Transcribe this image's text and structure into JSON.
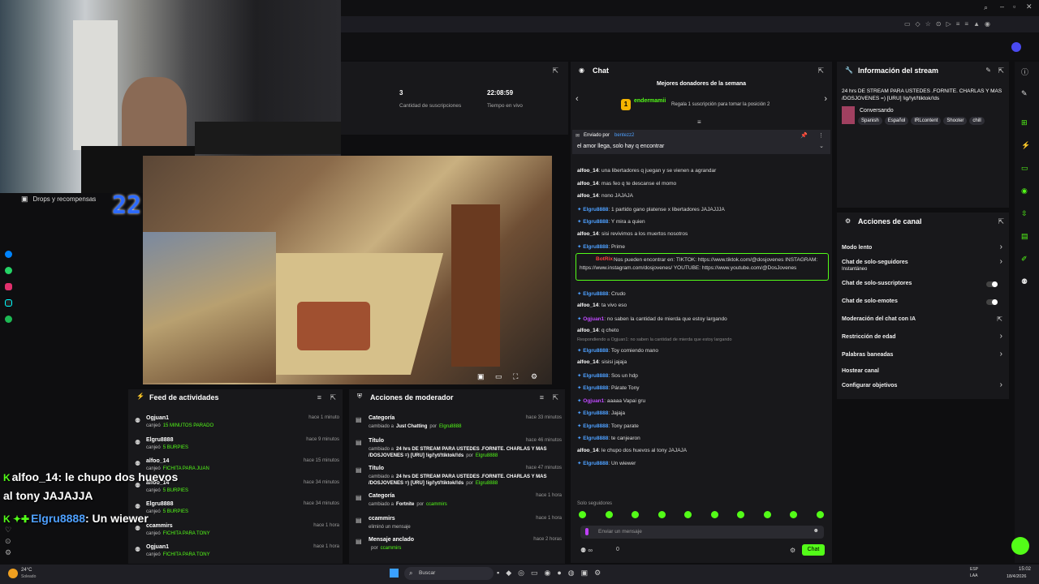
{
  "drops": {
    "label": "Drops y recompensas",
    "timer": "22:2:48"
  },
  "stats": [
    {
      "value": "3",
      "label": "Cantidad de suscripciones"
    },
    {
      "value": "22:08:59",
      "label": "Tiempo en vivo"
    }
  ],
  "chat": {
    "title": "Chat",
    "donors_title": "Mejores donadores de la semana",
    "donor_name": "endermamii",
    "donor_rank": "1",
    "donor_msg": "Regala 1 suscripción para tomar la posición 2",
    "pinned_by": "Enviado por",
    "pinned_user": "bentezz2",
    "pinned_text": "el amor llega, solo hay q encontrar",
    "messages": [
      {
        "user": "alfoo_14",
        "text": "una libertadores q juegan y se vienen a agrandar"
      },
      {
        "user": "alfoo_14",
        "text": "mas feo q te descanse el momo"
      },
      {
        "user": "alfoo_14",
        "text": "nono JAJAJA"
      },
      {
        "user": "Elgru8888",
        "text": "1 partido gano platense x libertadores JAJAJJJA"
      },
      {
        "user": "Elgru8888",
        "text": "Y mira a quien"
      },
      {
        "user": "alfoo_14",
        "text": "sisi revivimos a los muertos nosotros"
      },
      {
        "user": "Elgru8888",
        "text": "Prime"
      },
      {
        "user": "BotRix",
        "text": "Nos pueden encontrar en: TIKTOK: https://www.tiktok.com/@dosjovenes INSTAGRAM: https://www.instagram.com/dosjovenes/ YOUTUBE: https://www.youtube.com/@DosJovenes"
      },
      {
        "user": "Elgru8888",
        "text": "Crudo"
      },
      {
        "user": "alfoo_14",
        "text": "ta vivo eso"
      },
      {
        "user": "Ogjuan1",
        "text": "no saben la cantidad de mierda que estoy largando"
      },
      {
        "user": "alfoo_14",
        "text": "q cheto"
      },
      {
        "user": "Elgru8888",
        "text": "Toy comiendo mano",
        "reply": "Respondiendo a Ogjuan1: no saben la cantidad de mierda que estoy largando"
      },
      {
        "user": "alfoo_14",
        "text": "sisisi jajaja"
      },
      {
        "user": "Elgru8888",
        "text": "Sos un hdp"
      },
      {
        "user": "Elgru8888",
        "text": "Párate Tony"
      },
      {
        "user": "Ogjuan1",
        "text": "aaaaa Vapai gru"
      },
      {
        "user": "Elgru8888",
        "text": "Jajaja"
      },
      {
        "user": "Elgru8888",
        "text": "Tony parate"
      },
      {
        "user": "Elgru8888",
        "text": "te canjearon"
      },
      {
        "user": "alfoo_14",
        "text": "le chupo dos huevos al tony JAJAJA"
      },
      {
        "user": "Elgru8888",
        "text": "Un wiewer"
      }
    ],
    "followers_only": "Solo seguidores",
    "input_placeholder": "Enviar un mensaje",
    "send_label": "Chat",
    "count": "0"
  },
  "info": {
    "title": "Información del stream",
    "stream_title": "24 hrs DE STREAM PARA USTEDES .FORNITE. CHARLAS Y MAS /DOSJOVENES =) [URU] !ig/!yt/!tiktok/!ds",
    "category": "Conversando",
    "tags": [
      "Spanish",
      "Español",
      "IRLcontent",
      "Shooter",
      "chill"
    ]
  },
  "actions": {
    "title": "Acciones de canal",
    "items": [
      {
        "label": "Modo lento",
        "type": "chevron"
      },
      {
        "label": "Chat de solo-seguidores",
        "sub": "Instantáneo",
        "type": "chevron"
      },
      {
        "label": "Chat de solo-suscriptores",
        "type": "toggle"
      },
      {
        "label": "Chat de solo-emotes",
        "type": "toggle"
      },
      {
        "label": "Moderación del chat con IA",
        "type": "external"
      },
      {
        "label": "Restricción de edad",
        "type": "chevron"
      },
      {
        "label": "Palabras baneadas",
        "type": "chevron"
      },
      {
        "label": "Hostear canal",
        "type": "none"
      },
      {
        "label": "Configurar objetivos",
        "type": "chevron"
      }
    ]
  },
  "feed": {
    "title": "Feed de actividades",
    "items": [
      {
        "name": "Ogjuan1",
        "action": "canjeó",
        "reward": "15 MINUTOS PARADO",
        "time": "hace 1 minuto"
      },
      {
        "name": "Elgru8888",
        "action": "canjeó",
        "reward": "5 BURPIES",
        "time": "hace 9 minutos"
      },
      {
        "name": "alfoo_14",
        "action": "canjeó",
        "reward": "FICHITA PARA JUAN",
        "time": "hace 15 minutos"
      },
      {
        "name": "alfoo_14",
        "action": "canjeó",
        "reward": "5 BURPIES",
        "time": "hace 34 minutos"
      },
      {
        "name": "Elgru8888",
        "action": "canjeó",
        "reward": "5 BURPIES",
        "time": "hace 34 minutos"
      },
      {
        "name": "ccammirs",
        "action": "canjeó",
        "reward": "FICHITA PARA TONY",
        "time": "hace 1 hora"
      },
      {
        "name": "Ogjuan1",
        "action": "canjeó",
        "reward": "FICHITA PARA TONY",
        "time": "hace 1 hora"
      }
    ]
  },
  "mod": {
    "title": "Acciones de moderador",
    "items": [
      {
        "name": "Categoría",
        "desc": "cambiado a",
        "val": "Just Chatting",
        "by": "por",
        "user": "Elgru8888",
        "time": "hace 33 minutos"
      },
      {
        "name": "Título",
        "desc": "cambiado a",
        "val": "24 hrs DE STREAM PARA USTEDES .FORNITE. CHARLAS Y MAS /DOSJOVENES =) [URU] !ig/!yt/!tiktok/!ds",
        "by": "por",
        "user": "Elgru8888",
        "time": "hace 46 minutos"
      },
      {
        "name": "Título",
        "desc": "cambiado a",
        "val": "24 hrs DE STREAM PARA USTEDES .FORNITE. CHARLAS Y MAS /DOSJOVENES =) [URU] !ig/!yt/!tiktok/!ds",
        "by": "por",
        "user": "Elgru8888",
        "time": "hace 47 minutos"
      },
      {
        "name": "Categoría",
        "desc": "cambiado a",
        "val": "Fortnite",
        "by": "por",
        "user": "ccammirs",
        "time": "hace 1 hora"
      },
      {
        "name": "ccammirs",
        "desc": "eliminó un mensaje",
        "val": "",
        "by": "",
        "user": "",
        "time": "hace 1 hora"
      },
      {
        "name": "Mensaje anclado",
        "desc": "",
        "val": "",
        "by": "por",
        "user": "ccammirs",
        "time": "hace 2 horas"
      }
    ]
  },
  "overlay": {
    "line1_user": "alfoo_14",
    "line1_text": ": le chupo dos huevos",
    "line2": "al tony JAJAJJA",
    "line3_user": "Elgru8888",
    "line3_text": ": Un wiewer"
  },
  "taskbar": {
    "weather": "24°C",
    "weather_sub": "Soleado",
    "search": "Buscar",
    "lang": "ESP",
    "lang2": "LAA",
    "time": "15:02",
    "date": "18/4/2026"
  }
}
